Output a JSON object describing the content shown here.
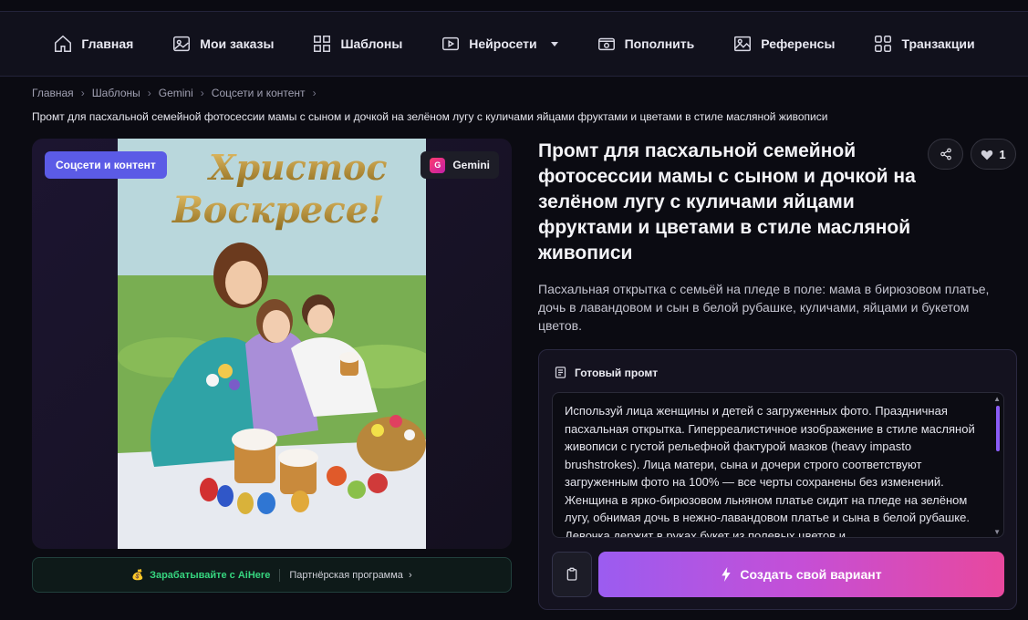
{
  "nav": {
    "items": [
      {
        "label": "Главная",
        "icon": "home-icon"
      },
      {
        "label": "Мои заказы",
        "icon": "image-icon"
      },
      {
        "label": "Шаблоны",
        "icon": "grid-icon"
      },
      {
        "label": "Нейросети",
        "icon": "play-icon"
      },
      {
        "label": "Пополнить",
        "icon": "wallet-icon"
      },
      {
        "label": "Референсы",
        "icon": "picture-icon"
      },
      {
        "label": "Транзакции",
        "icon": "apps-icon"
      }
    ]
  },
  "breadcrumb": [
    "Главная",
    "Шаблоны",
    "Gemini",
    "Соцсети и контент"
  ],
  "page_subtitle": "Промт для пасхальной семейной фотосессии мамы с сыном и дочкой на зелёном лугу с куличами яйцами фруктами и цветами в стиле масляной живописи",
  "image": {
    "category_badge": "Соцсети и контент",
    "model_badge": "Gemini",
    "model_logo_letter": "G",
    "postcard_text_line1": "Христос",
    "postcard_text_line2": "Воскресе!"
  },
  "affiliate": {
    "main": "Зарабатывайте с AiHere",
    "link": "Партнёрская программа"
  },
  "detail": {
    "title": "Промт для пасхальной семейной фотосессии мамы с сыном и дочкой на зелёном лугу с куличами яйцами фруктами и цветами в стиле масляной живописи",
    "likes": "1",
    "description": "Пасхальная открытка с семьёй на пледе в поле: мама в бирюзовом платье, дочь в лавандовом и сын в белой рубашке, куличами, яйцами и букетом цветов."
  },
  "prompt": {
    "header": "Готовый промт",
    "text": "Используй лица женщины и детей с загруженных фото. Праздничная пасхальная открытка. Гиперреалистичное изображение в стиле масляной живописи с густой рельефной фактурой мазков (heavy impasto brushstrokes). Лица матери, сына и дочери строго соответствуют загруженным фото на 100% — все черты сохранены без изменений. Женщина в ярко-бирюзовом льняном платье сидит на пледе на зелёном лугу, обнимая дочь в нежно-лавандовом платье и сына в белой рубашке. Девочка держит в руках букет из полевых цветов и",
    "create_label": "Создать свой вариант"
  },
  "colors": {
    "accent": "#5b5be6",
    "gradient_start": "#9b5cf0",
    "gradient_end": "#e8489e",
    "affiliate_green": "#36d57f"
  }
}
